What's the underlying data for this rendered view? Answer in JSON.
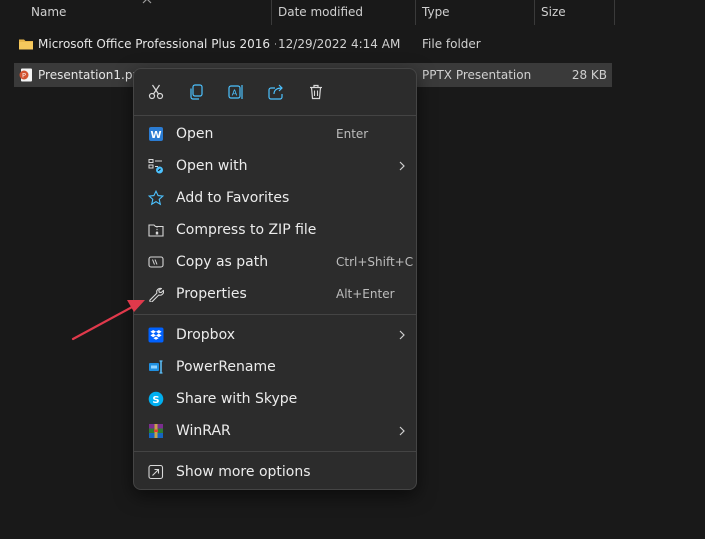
{
  "columns": {
    "name": "Name",
    "date_modified": "Date modified",
    "type": "Type",
    "size": "Size"
  },
  "rows": [
    {
      "name": "Microsoft Office Professional Plus 2016 +...",
      "date": "12/29/2022 4:14 AM",
      "type": "File folder",
      "size": ""
    },
    {
      "name": "Presentation1.pptx",
      "date": "",
      "type": "PPTX Presentation",
      "size": "28 KB"
    }
  ],
  "context_menu": {
    "quick_actions": [
      "cut-icon",
      "copy-icon",
      "rename-icon",
      "share-icon",
      "delete-icon"
    ],
    "items": [
      {
        "label": "Open",
        "shortcut": "Enter",
        "icon": "word-icon"
      },
      {
        "label": "Open with",
        "shortcut": "",
        "icon": "open-with-icon",
        "submenu": true
      },
      {
        "label": "Add to Favorites",
        "shortcut": "",
        "icon": "star-icon"
      },
      {
        "label": "Compress to ZIP file",
        "shortcut": "",
        "icon": "zip-icon"
      },
      {
        "label": "Copy as path",
        "shortcut": "Ctrl+Shift+C",
        "icon": "path-icon"
      },
      {
        "label": "Properties",
        "shortcut": "Alt+Enter",
        "icon": "wrench-icon"
      },
      {
        "label": "Dropbox",
        "shortcut": "",
        "icon": "dropbox-icon",
        "submenu": true
      },
      {
        "label": "PowerRename",
        "shortcut": "",
        "icon": "powerrename-icon"
      },
      {
        "label": "Share with Skype",
        "shortcut": "",
        "icon": "skype-icon"
      },
      {
        "label": "WinRAR",
        "shortcut": "",
        "icon": "winrar-icon",
        "submenu": true
      },
      {
        "label": "Show more options",
        "shortcut": "",
        "icon": "more-options-icon"
      }
    ]
  },
  "colors": {
    "background": "#191919",
    "menu_background": "#2c2c2c",
    "selection": "#3a3a3a",
    "annotation_arrow": "#e0394b"
  }
}
